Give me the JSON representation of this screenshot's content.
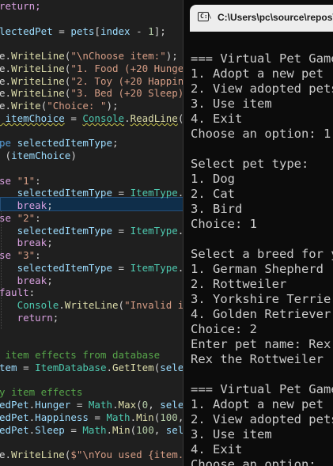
{
  "editor": {
    "lines": [
      [
        [
          "return;",
          "kw2"
        ]
      ],
      [
        [
          "",
          ""
        ]
      ],
      [
        [
          "lectedPet",
          "var"
        ],
        [
          " = ",
          "pl"
        ],
        [
          "pets",
          "var"
        ],
        [
          "[",
          "pl"
        ],
        [
          "index",
          "var"
        ],
        [
          " - ",
          "pl"
        ],
        [
          "1",
          "num"
        ],
        [
          "];",
          "pl"
        ]
      ],
      [
        [
          "",
          ""
        ]
      ],
      [
        [
          "e.",
          "pl"
        ],
        [
          "WriteLine",
          "meth"
        ],
        [
          "(",
          "pl"
        ],
        [
          "\"\\nChoose item:\"",
          "str"
        ],
        [
          ");",
          "pl"
        ]
      ],
      [
        [
          "e.",
          "pl"
        ],
        [
          "WriteLine",
          "meth"
        ],
        [
          "(",
          "pl"
        ],
        [
          "\"1. Food (+20 Hunger)\"",
          "str"
        ],
        [
          ");",
          "pl"
        ]
      ],
      [
        [
          "e.",
          "pl"
        ],
        [
          "WriteLine",
          "meth"
        ],
        [
          "(",
          "pl"
        ],
        [
          "\"2. Toy (+20 Happiness",
          "str"
        ]
      ],
      [
        [
          "e.",
          "pl"
        ],
        [
          "WriteLine",
          "meth"
        ],
        [
          "(",
          "pl"
        ],
        [
          "\"3. Bed (+20 Sleep)\"",
          "str"
        ],
        [
          ");",
          "pl"
        ]
      ],
      [
        [
          "e.",
          "pl"
        ],
        [
          "Write",
          "meth"
        ],
        [
          "(",
          "pl"
        ],
        [
          "\"Choice: \"",
          "str"
        ],
        [
          ");",
          "pl"
        ]
      ],
      [
        [
          " itemChoice",
          "var"
        ],
        [
          " = ",
          "pl"
        ],
        [
          "Console",
          "type"
        ],
        [
          ".",
          "pl"
        ],
        [
          "ReadLine",
          "meth"
        ],
        [
          "();",
          "pl"
        ]
      ],
      [
        [
          "",
          ""
        ]
      ],
      [
        [
          "pe ",
          "kw"
        ],
        [
          "selectedItemType",
          "var"
        ],
        [
          ";",
          "pl"
        ]
      ],
      [
        [
          " (",
          "pl"
        ],
        [
          "itemChoice",
          "var"
        ],
        [
          ")",
          "pl"
        ]
      ],
      [
        [
          "",
          ""
        ]
      ],
      [
        [
          "se ",
          "kw2"
        ],
        [
          "\"1\"",
          "str"
        ],
        [
          ":",
          "pl"
        ]
      ],
      [
        [
          "   selectedItemType",
          "var"
        ],
        [
          " = ",
          "pl"
        ],
        [
          "ItemType",
          "type"
        ],
        [
          ".",
          "pl"
        ],
        [
          "Food",
          "var"
        ]
      ],
      [
        [
          "   ",
          "pl"
        ],
        [
          "break",
          "kw2"
        ],
        [
          ";",
          "pl"
        ]
      ],
      [
        [
          "se ",
          "kw2"
        ],
        [
          "\"2\"",
          "str"
        ],
        [
          ":",
          "pl"
        ]
      ],
      [
        [
          "   selectedItemType",
          "var"
        ],
        [
          " = ",
          "pl"
        ],
        [
          "ItemType",
          "type"
        ],
        [
          ".",
          "pl"
        ],
        [
          "Toy",
          "var"
        ],
        [
          ";",
          "pl"
        ]
      ],
      [
        [
          "   ",
          "pl"
        ],
        [
          "break",
          "kw2"
        ],
        [
          ";",
          "pl"
        ]
      ],
      [
        [
          "se ",
          "kw2"
        ],
        [
          "\"3\"",
          "str"
        ],
        [
          ":",
          "pl"
        ]
      ],
      [
        [
          "   selectedItemType",
          "var"
        ],
        [
          " = ",
          "pl"
        ],
        [
          "ItemType",
          "type"
        ],
        [
          ".",
          "pl"
        ],
        [
          "Bed",
          "var"
        ],
        [
          ";",
          "pl"
        ]
      ],
      [
        [
          "   ",
          "pl"
        ],
        [
          "break",
          "kw2"
        ],
        [
          ";",
          "pl"
        ]
      ],
      [
        [
          "fault",
          "kw2"
        ],
        [
          ":",
          "pl"
        ]
      ],
      [
        [
          "   ",
          "pl"
        ],
        [
          "Console",
          "type"
        ],
        [
          ".",
          "pl"
        ],
        [
          "WriteLine",
          "meth"
        ],
        [
          "(",
          "pl"
        ],
        [
          "\"Invalid item",
          "str"
        ]
      ],
      [
        [
          "   ",
          "pl"
        ],
        [
          "return",
          "kw2"
        ],
        [
          ";",
          "pl"
        ]
      ],
      [
        [
          "",
          ""
        ]
      ],
      [
        [
          "",
          ""
        ]
      ],
      [
        [
          " item effects from database",
          "cm"
        ]
      ],
      [
        [
          "tem",
          "var"
        ],
        [
          " = ",
          "pl"
        ],
        [
          "ItemDatabase",
          "type"
        ],
        [
          ".",
          "pl"
        ],
        [
          "GetItem",
          "meth"
        ],
        [
          "(",
          "pl"
        ],
        [
          "selecte",
          "var"
        ]
      ],
      [
        [
          "",
          ""
        ]
      ],
      [
        [
          "y item effects",
          "cm"
        ]
      ],
      [
        [
          "edPet",
          "var"
        ],
        [
          ".",
          "pl"
        ],
        [
          "Hunger",
          "var"
        ],
        [
          " = ",
          "pl"
        ],
        [
          "Math",
          "type"
        ],
        [
          ".",
          "pl"
        ],
        [
          "Max",
          "meth"
        ],
        [
          "(",
          "pl"
        ],
        [
          "0",
          "num"
        ],
        [
          ", ",
          "pl"
        ],
        [
          "selecte",
          "var"
        ]
      ],
      [
        [
          "edPet",
          "var"
        ],
        [
          ".",
          "pl"
        ],
        [
          "Happiness",
          "var"
        ],
        [
          " = ",
          "pl"
        ],
        [
          "Math",
          "type"
        ],
        [
          ".",
          "pl"
        ],
        [
          "Min",
          "meth"
        ],
        [
          "(",
          "pl"
        ],
        [
          "100",
          "num"
        ],
        [
          ", ",
          "pl"
        ],
        [
          "se",
          "var"
        ]
      ],
      [
        [
          "edPet",
          "var"
        ],
        [
          ".",
          "pl"
        ],
        [
          "Sleep",
          "var"
        ],
        [
          " = ",
          "pl"
        ],
        [
          "Math",
          "type"
        ],
        [
          ".",
          "pl"
        ],
        [
          "Min",
          "meth"
        ],
        [
          "(",
          "pl"
        ],
        [
          "100",
          "num"
        ],
        [
          ", ",
          "pl"
        ],
        [
          "select",
          "var"
        ]
      ],
      [
        [
          "",
          ""
        ]
      ],
      [
        [
          "e.",
          "pl"
        ],
        [
          "WriteLine",
          "meth"
        ],
        [
          "(",
          "pl"
        ],
        [
          "$\"\\nYou used {item.Nam",
          "str"
        ]
      ]
    ]
  },
  "console": {
    "title": "C:\\Users\\pc\\source\\repos\\",
    "icon": "terminal-icon",
    "lines": [
      "=== Virtual Pet Game",
      "1. Adopt a new pet",
      "2. View adopted pets",
      "3. Use item",
      "4. Exit",
      "Choose an option: 1",
      "",
      "Select pet type:",
      "1. Dog",
      "2. Cat",
      "3. Bird",
      "Choice: 1",
      "",
      "Select a breed for y",
      "1. German Shepherd",
      "2. Rottweiler",
      "3. Yorkshire Terrier",
      "4. Golden Retriever",
      "Choice: 2",
      "Enter pet name: Rex",
      "Rex the Rottweiler (",
      "",
      "=== Virtual Pet Game",
      "1. Adopt a new pet",
      "2. View adopted pets",
      "3. Use item",
      "4. Exit",
      "Choose an option:"
    ]
  }
}
